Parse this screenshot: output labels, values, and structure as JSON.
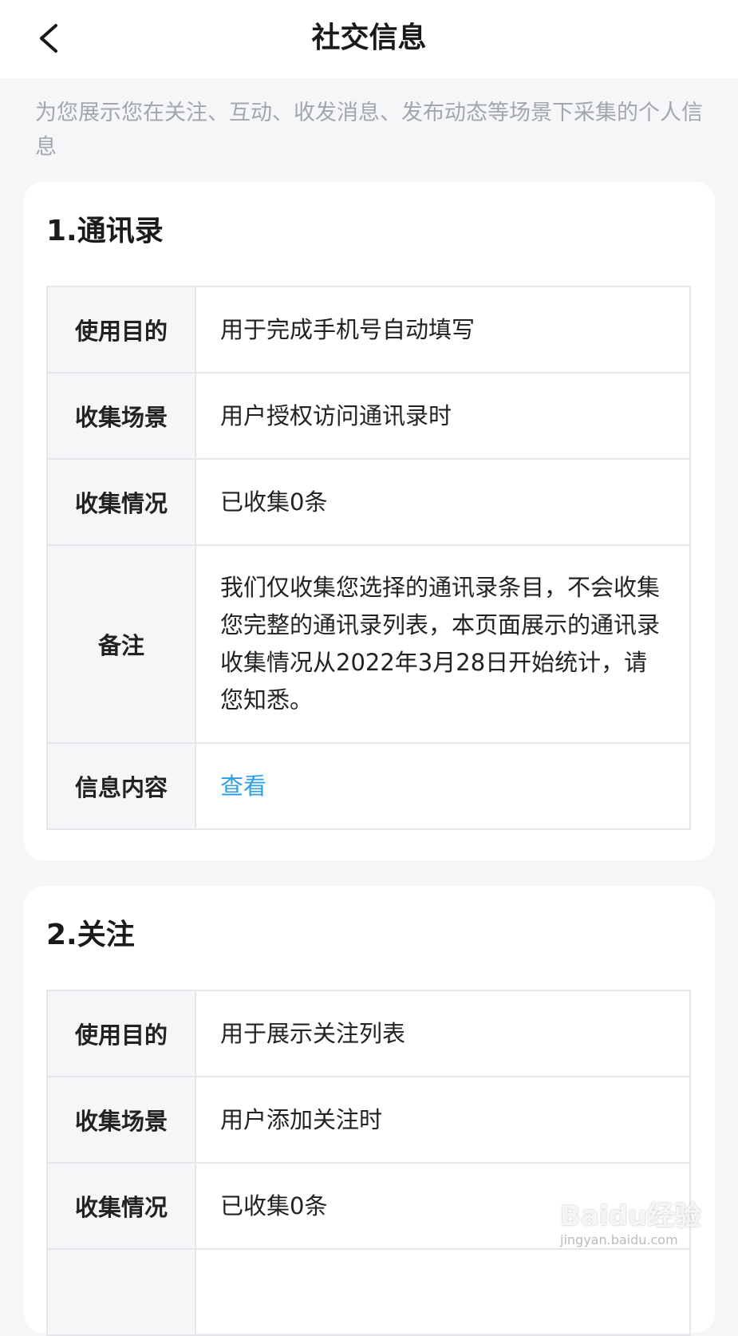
{
  "nav": {
    "title": "社交信息",
    "back_icon": "chevron-left-icon"
  },
  "intro": "为您展示您在关注、互动、收发消息、发布动态等场景下采集的个人信息",
  "sections": [
    {
      "title": "1.通讯录",
      "rows": [
        {
          "key": "使用目的",
          "value": "用于完成手机号自动填写"
        },
        {
          "key": "收集场景",
          "value": "用户授权访问通讯录时"
        },
        {
          "key": "收集情况",
          "value": "已收集0条"
        },
        {
          "key": "备注",
          "value": "我们仅收集您选择的通讯录条目，不会收集您完整的通讯录列表，本页面展示的通讯录收集情况从2022年3月28日开始统计，请您知悉。"
        },
        {
          "key": "信息内容",
          "value": "查看"
        }
      ]
    },
    {
      "title": "2.关注",
      "rows": [
        {
          "key": "使用目的",
          "value": "用于展示关注列表"
        },
        {
          "key": "收集场景",
          "value": "用户添加关注时"
        },
        {
          "key": "收集情况",
          "value": "已收集0条"
        }
      ]
    }
  ],
  "colors": {
    "link": "#2d9ee8",
    "background": "#f5f6f8",
    "intro_text": "#a3a7ad"
  },
  "watermark": {
    "brand": "Baidu经验",
    "url": "jingyan.baidu.com"
  }
}
